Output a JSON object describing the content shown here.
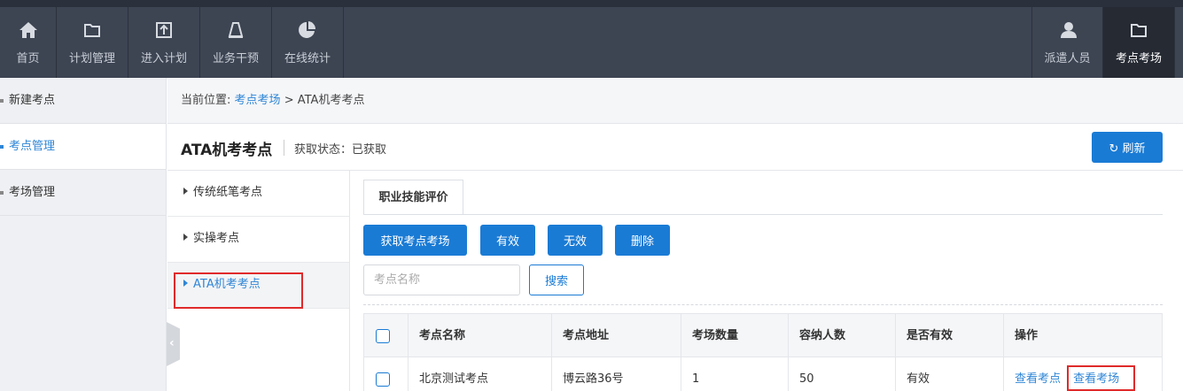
{
  "topnav": {
    "left_items": [
      {
        "label": "首页",
        "icon": "home-icon"
      },
      {
        "label": "计划管理",
        "icon": "folder-icon"
      },
      {
        "label": "进入计划",
        "icon": "upload-icon"
      },
      {
        "label": "业务干预",
        "icon": "cone-icon"
      },
      {
        "label": "在线统计",
        "icon": "pie-chart-icon"
      }
    ],
    "right_items": [
      {
        "label": "派遣人员",
        "icon": "user-icon"
      },
      {
        "label": "考点考场",
        "icon": "folder-icon",
        "active": true
      }
    ]
  },
  "sidebar": {
    "items": [
      {
        "label": "新建考点"
      },
      {
        "label": "考点管理",
        "active": true
      },
      {
        "label": "考场管理"
      }
    ]
  },
  "breadcrumb": {
    "prefix": "当前位置:",
    "link": "考点考场",
    "separator": ">",
    "current": "ATA机考考点"
  },
  "header": {
    "title": "ATA机考考点",
    "status": "获取状态：已获取",
    "refresh_label": "刷新"
  },
  "subnav": {
    "items": [
      {
        "label": "传统纸笔考点"
      },
      {
        "label": "实操考点"
      },
      {
        "label": "ATA机考考点",
        "active": true
      }
    ]
  },
  "tabs": [
    {
      "label": "职业技能评价"
    }
  ],
  "toolbar": {
    "fetch_label": "获取考点考场",
    "valid_label": "有效",
    "invalid_label": "无效",
    "delete_label": "删除",
    "search_placeholder": "考点名称",
    "search_label": "搜索"
  },
  "table": {
    "columns": [
      "考点名称",
      "考点地址",
      "考场数量",
      "容纳人数",
      "是否有效",
      "操作"
    ],
    "rows": [
      {
        "name": "北京测试考点",
        "address": "博云路36号",
        "room_count": "1",
        "capacity": "50",
        "valid": "有效",
        "actions": [
          "查看考点",
          "查看考场"
        ]
      }
    ]
  },
  "colors": {
    "topbar": "#3d4553",
    "primary": "#1a7bd5",
    "link": "#2f86d6",
    "highlight": "#e02a2a"
  }
}
